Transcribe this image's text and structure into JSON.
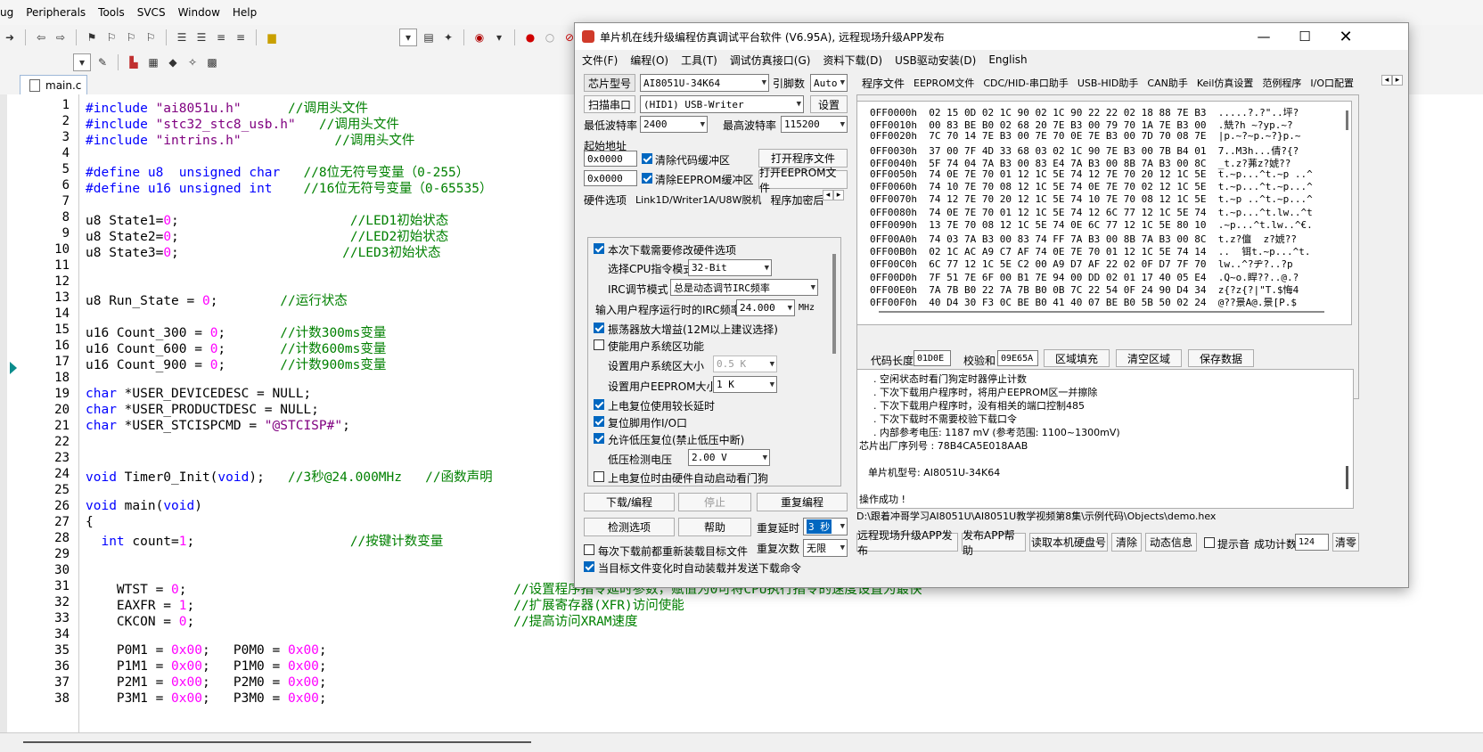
{
  "ide": {
    "menu": [
      "ug",
      "Peripherals",
      "Tools",
      "SVCS",
      "Window",
      "Help"
    ],
    "tab": "main.c",
    "code_lines": [
      {
        "n": "1",
        "segs": [
          [
            "pp",
            "#include "
          ],
          [
            "str",
            "\"ai8051u.h\""
          ],
          [
            "cm",
            "      //调用头文件"
          ]
        ]
      },
      {
        "n": "2",
        "segs": [
          [
            "pp",
            "#include "
          ],
          [
            "str",
            "\"stc32_stc8_usb.h\""
          ],
          [
            "cm",
            "   //调用头文件"
          ]
        ]
      },
      {
        "n": "3",
        "segs": [
          [
            "pp",
            "#include "
          ],
          [
            "str",
            "\"intrins.h\""
          ],
          [
            "cm",
            "            //调用头文件"
          ]
        ]
      },
      {
        "n": "4",
        "segs": []
      },
      {
        "n": "5",
        "segs": [
          [
            "pp",
            "#define u8  "
          ],
          [
            "kw",
            "unsigned char"
          ],
          [
            "cm",
            "   //8位无符号变量（0-255）"
          ]
        ]
      },
      {
        "n": "6",
        "segs": [
          [
            "pp",
            "#define u16 "
          ],
          [
            "kw",
            "unsigned int"
          ],
          [
            "cm",
            "    //16位无符号变量（0-65535）"
          ]
        ]
      },
      {
        "n": "7",
        "segs": []
      },
      {
        "n": "8",
        "segs": [
          [
            "",
            "u8 State1="
          ],
          [
            "num",
            "0"
          ],
          [
            "",
            ";"
          ],
          [
            "cm",
            "                      //LED1初始状态"
          ]
        ]
      },
      {
        "n": "9",
        "segs": [
          [
            "",
            "u8 State2="
          ],
          [
            "num",
            "0"
          ],
          [
            "",
            ";"
          ],
          [
            "cm",
            "                      //LED2初始状态"
          ]
        ]
      },
      {
        "n": "10",
        "segs": [
          [
            "",
            "u8 State3="
          ],
          [
            "num",
            "0"
          ],
          [
            "",
            ";"
          ],
          [
            "cm",
            "                     //LED3初始状态"
          ]
        ]
      },
      {
        "n": "11",
        "segs": []
      },
      {
        "n": "12",
        "segs": []
      },
      {
        "n": "13",
        "segs": [
          [
            "",
            "u8 Run_State = "
          ],
          [
            "num",
            "0"
          ],
          [
            "",
            ";"
          ],
          [
            "cm",
            "        //运行状态"
          ]
        ]
      },
      {
        "n": "14",
        "segs": []
      },
      {
        "n": "15",
        "segs": [
          [
            "",
            "u16 Count_300 = "
          ],
          [
            "num",
            "0"
          ],
          [
            "",
            ";"
          ],
          [
            "cm",
            "       //计数300ms变量"
          ]
        ]
      },
      {
        "n": "16",
        "segs": [
          [
            "",
            "u16 Count_600 = "
          ],
          [
            "num",
            "0"
          ],
          [
            "",
            ";"
          ],
          [
            "cm",
            "       //计数600ms变量"
          ]
        ]
      },
      {
        "n": "17",
        "segs": [
          [
            "",
            "u16 Count_900 = "
          ],
          [
            "num",
            "0"
          ],
          [
            "",
            ";"
          ],
          [
            "cm",
            "       //计数900ms变量"
          ]
        ]
      },
      {
        "n": "18",
        "segs": []
      },
      {
        "n": "19",
        "segs": [
          [
            "kw",
            "char"
          ],
          [
            "",
            " *USER_DEVICEDESC = NULL;"
          ]
        ]
      },
      {
        "n": "20",
        "segs": [
          [
            "kw",
            "char"
          ],
          [
            "",
            " *USER_PRODUCTDESC = NULL;"
          ]
        ]
      },
      {
        "n": "21",
        "segs": [
          [
            "kw",
            "char"
          ],
          [
            "",
            " *USER_STCISPCMD = "
          ],
          [
            "str",
            "\"@STCISP#\""
          ],
          [
            "",
            ";"
          ]
        ]
      },
      {
        "n": "22",
        "segs": []
      },
      {
        "n": "23",
        "segs": []
      },
      {
        "n": "24",
        "segs": [
          [
            "kw",
            "void"
          ],
          [
            "",
            " Timer0_Init("
          ],
          [
            "kw",
            "void"
          ],
          [
            "",
            ");"
          ],
          [
            "cm",
            "   //3秒@24.000MHz   //函数声明"
          ]
        ]
      },
      {
        "n": "25",
        "segs": []
      },
      {
        "n": "26",
        "segs": [
          [
            "kw",
            "void"
          ],
          [
            "",
            " main("
          ],
          [
            "kw",
            "void"
          ],
          [
            "",
            ")"
          ]
        ]
      },
      {
        "n": "27",
        "segs": [
          [
            "",
            "{"
          ]
        ]
      },
      {
        "n": "28",
        "segs": [
          [
            "kw",
            "  int"
          ],
          [
            "",
            " count="
          ],
          [
            "num",
            "1"
          ],
          [
            "",
            ";"
          ],
          [
            "cm",
            "                    //按键计数变量"
          ]
        ]
      },
      {
        "n": "29",
        "segs": []
      },
      {
        "n": "30",
        "segs": []
      },
      {
        "n": "31",
        "segs": [
          [
            "",
            "    WTST = "
          ],
          [
            "num",
            "0"
          ],
          [
            "",
            ";"
          ],
          [
            "cm",
            "                                          //设置程序指令延时参数，赋值为0可将CPU执行指令的速度设置为最快"
          ]
        ]
      },
      {
        "n": "32",
        "segs": [
          [
            "",
            "    EAXFR = "
          ],
          [
            "num",
            "1"
          ],
          [
            "",
            ";"
          ],
          [
            "cm",
            "                                         //扩展寄存器(XFR)访问使能"
          ]
        ]
      },
      {
        "n": "33",
        "segs": [
          [
            "",
            "    CKCON = "
          ],
          [
            "num",
            "0"
          ],
          [
            "",
            ";"
          ],
          [
            "cm",
            "                                         //提高访问XRAM速度"
          ]
        ]
      },
      {
        "n": "34",
        "segs": []
      },
      {
        "n": "35",
        "segs": [
          [
            "",
            "    P0M1 = "
          ],
          [
            "num",
            "0x00"
          ],
          [
            "",
            ";   P0M0 = "
          ],
          [
            "num",
            "0x00"
          ],
          [
            "",
            ";"
          ]
        ]
      },
      {
        "n": "36",
        "segs": [
          [
            "",
            "    P1M1 = "
          ],
          [
            "num",
            "0x00"
          ],
          [
            "",
            ";   P1M0 = "
          ],
          [
            "num",
            "0x00"
          ],
          [
            "",
            ";"
          ]
        ]
      },
      {
        "n": "37",
        "segs": [
          [
            "",
            "    P2M1 = "
          ],
          [
            "num",
            "0x00"
          ],
          [
            "",
            ";   P2M0 = "
          ],
          [
            "num",
            "0x00"
          ],
          [
            "",
            ";"
          ]
        ]
      },
      {
        "n": "38",
        "segs": [
          [
            "",
            "    P3M1 = "
          ],
          [
            "num",
            "0x00"
          ],
          [
            "",
            ";   P3M0 = "
          ],
          [
            "num",
            "0x00"
          ],
          [
            "",
            ";"
          ]
        ]
      }
    ]
  },
  "dialog": {
    "title": "单片机在线升级编程仿真调试平台软件 (V6.95A), 远程现场升级APP发布",
    "menu": [
      "文件(F)",
      "编程(O)",
      "工具(T)",
      "调试仿真接口(G)",
      "资料下载(D)",
      "USB驱动安装(D)",
      "English"
    ],
    "chip_label": "芯片型号",
    "chip_value": "AI8051U-34K64",
    "pin_label": "引脚数",
    "pin_value": "Auto",
    "scan_btn": "扫描串口",
    "port_value": "(HID1) USB-Writer",
    "settings_btn": "设置",
    "min_baud_label": "最低波特率",
    "min_baud": "2400",
    "max_baud_label": "最高波特率",
    "max_baud": "115200",
    "start_addr_label": "起始地址",
    "addr1": "0x0000",
    "clr_code": "清除代码缓冲区",
    "open_prog": "打开程序文件",
    "addr2": "0x0000",
    "clr_eeprom": "清除EEPROM缓冲区",
    "open_eeprom": "打开EEPROM文件",
    "left_tabs": [
      "硬件选项",
      "Link1D/Writer1A/U8W脱机",
      "程序加密后"
    ],
    "hw": {
      "opt_modify": "本次下载需要修改硬件选项",
      "cpu_mode_label": "选择CPU指令模式",
      "cpu_mode": "32-Bit",
      "irc_label": "IRC调节模式",
      "irc_value": "总是动态调节IRC频率",
      "freq_label": "输入用户程序运行时的IRC频率",
      "freq_value": "24.000",
      "freq_unit": "MHz",
      "osc_gain": "振荡器放大增益(12M以上建议选择)",
      "user_sys": "使能用户系统区功能",
      "user_sys_size_label": "设置用户系统区大小",
      "user_sys_size": "0.5 K",
      "user_eeprom_label": "设置用户EEPROM大小",
      "user_eeprom": "1  K",
      "long_delay": "上电复位使用较长延时",
      "reset_io": "复位脚用作I/O口",
      "lvd_reset": "允许低压复位(禁止低压中断)",
      "lvd_label": "低压检测电压",
      "lvd_value": "2.00 V",
      "wdt": "上电复位时由硬件自动启动看门狗"
    },
    "btn_download": "下载/编程",
    "btn_stop": "停止",
    "btn_reprog": "重复编程",
    "btn_check": "检测选项",
    "btn_help": "帮助",
    "repeat_delay_label": "重复延时",
    "repeat_delay": "3 秒",
    "repeat_count_label": "重复次数",
    "repeat_count": "无限",
    "reload_each": "每次下载前都重新装载目标文件",
    "auto_load": "当目标文件变化时自动装载并发送下载命令",
    "right_tabs": [
      "程序文件",
      "EEPROM文件",
      "CDC/HID-串口助手",
      "USB-HID助手",
      "CAN助手",
      "Keil仿真设置",
      "范例程序",
      "I/O口配置"
    ],
    "hex_rows": [
      [
        "0FF0000h",
        "02 15 0D 02 1C 90 02 1C 90 22 22 02 18 88 7E B3",
        ".....?.?\"..坪?"
      ],
      [
        "0FF0010h",
        "00 83 BE B0 02 68 20 7E B3 00 79 70 1A 7E B3 00",
        ".兟?h ~?yp.~?"
      ],
      [
        "0FF0020h",
        "7C 70 14 7E B3 00 7E 70 0E 7E B3 00 7D 70 08 7E",
        "|p.~?~p.~?}p.~"
      ],
      [
        "0FF0030h",
        "37 00 7F 4D 33 68 03 02 1C 90 7E B3 00 7B B4 01",
        "7..M3h...倩?{?"
      ],
      [
        "0FF0040h",
        "5F 74 04 7A B3 00 83 E4 7A B3 00 8B 7A B3 00 8C",
        "_t.z?茀z?婋??"
      ],
      [
        "0FF0050h",
        "74 0E 7E 70 01 12 1C 5E 74 12 7E 70 20 12 1C 5E",
        "t.~p...^t.~p ..^"
      ],
      [
        "0FF0060h",
        "74 10 7E 70 08 12 1C 5E 74 0E 7E 70 02 12 1C 5E",
        "t.~p...^t.~p...^"
      ],
      [
        "0FF0070h",
        "74 12 7E 70 20 12 1C 5E 74 10 7E 70 08 12 1C 5E",
        "t.~p ..^t.~p...^"
      ],
      [
        "0FF0080h",
        "74 0E 7E 70 01 12 1C 5E 74 12 6C 77 12 1C 5E 74",
        "t.~p...^t.lw..^t"
      ],
      [
        "0FF0090h",
        "13 7E 70 08 12 1C 5E 74 0E 6C 77 12 1C 5E 80 10",
        ".~p...^t.lw..^€."
      ],
      [
        "0FF00A0h",
        "74 03 7A B3 00 83 74 FF 7A B3 00 8B 7A B3 00 8C",
        "t.z?儃  z?婋??"
      ],
      [
        "0FF00B0h",
        "02 1C AC A9 C7 AF 74 0E 7E 70 01 12 1C 5E 74 14",
        "..  铒t.~p...^t."
      ],
      [
        "0FF00C0h",
        "6C 77 12 1C 5E C2 00 A9 D7 AF 22 02 0F D7 7F 70",
        "lw..^?ヂ?..?p"
      ],
      [
        "0FF00D0h",
        "7F 51 7E 6F 00 B1 7E 94 00 DD 02 01 17 40 05 E4",
        ".Q~o.睅??..@.?"
      ],
      [
        "0FF00E0h",
        "7A 7B B0 22 7A 7B B0 0B 7C 22 54 0F 24 90 D4 34",
        "z{?z{?|\"T.$悔4"
      ],
      [
        "0FF00F0h",
        "40 D4 30 F3 0C BE B0 41 40 07 BE B0 5B 50 02 24",
        "@??景A@.景[P.$"
      ]
    ],
    "code_len_label": "代码长度",
    "code_len": "01D0E",
    "checksum_label": "校验和",
    "checksum": "09E65A",
    "btn_fill": "区域填充",
    "btn_clear_area": "清空区域",
    "btn_save": "保存数据",
    "log_lines": [
      ". 空闲状态时看门狗定时器停止计数",
      ". 下次下载用户程序时，将用户EEPROM区一并擦除",
      ". 下次下载用户程序时，没有相关的端口控制485",
      ". 下次下载时不需要校验下载口令",
      ". 内部参考电压: 1187 mV (参考范围: 1100~1300mV)",
      "芯片出厂序列号 : 78B4CA5E018AAB",
      "",
      "单片机型号: AI8051U-34K64",
      "",
      "操作成功 !"
    ],
    "path": "D:\\跟着冲哥学习AI8051U\\AI8051U教学视频第8集\\示例代码\\Objects\\demo.hex",
    "btn_remote": "远程现场升级APP发布",
    "btn_app_help": "发布APP帮助",
    "btn_read_hd": "读取本机硬盘号",
    "btn_clear": "清除",
    "btn_dyn": "动态信息",
    "prompt_sound": "提示音",
    "success_label": "成功计数",
    "success_count": "124",
    "btn_clear2": "清零"
  }
}
